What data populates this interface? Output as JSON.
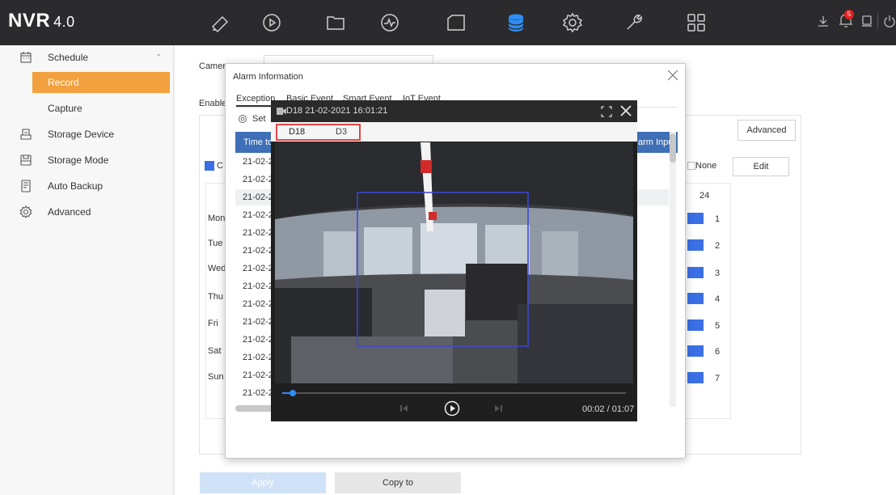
{
  "app": {
    "title": "NVR",
    "version": "4.0"
  },
  "topnav": {
    "icons": [
      "live-view-icon",
      "playback-icon",
      "file-icon",
      "smart-analysis-icon",
      "camera-icon",
      "storage-icon",
      "settings-icon",
      "maintenance-icon",
      "apps-icon"
    ],
    "active": "storage-icon",
    "right_icons": [
      "download-icon",
      "alarm-icon",
      "user-icon",
      "power-icon"
    ],
    "alarm_count": "5"
  },
  "sidebar": {
    "items": [
      {
        "label": "Schedule",
        "icon": "calendar-icon",
        "expanded": true
      },
      {
        "label": "Record",
        "active": true
      },
      {
        "label": "Capture"
      },
      {
        "label": "Storage Device",
        "icon": "storage-device-icon"
      },
      {
        "label": "Storage Mode",
        "icon": "storage-mode-icon"
      },
      {
        "label": "Auto Backup",
        "icon": "backup-icon"
      },
      {
        "label": "Advanced",
        "icon": "gear-icon"
      }
    ]
  },
  "main": {
    "camera_label": "Camer",
    "enable_label": "Enable",
    "advanced_button": "Advanced",
    "legend_partial": "C",
    "none_label": "None",
    "edit_button": "Edit",
    "hour_24": "24",
    "days": [
      "Mon",
      "Tue",
      "Wed",
      "Thu",
      "Fri",
      "Sat",
      "Sun"
    ],
    "day_numbers": [
      "1",
      "2",
      "3",
      "4",
      "5",
      "6",
      "7"
    ],
    "apply_button": "Apply",
    "copy_to_button": "Copy to"
  },
  "alarm_dialog": {
    "title": "Alarm Information",
    "tabs": [
      "Exception",
      "Basic Event",
      "Smart Event",
      "IoT Event"
    ],
    "set_label": "Set",
    "col_time": "Time to",
    "col_alarm_input": "arm Inpu",
    "rows": [
      "21-02-2",
      "21-02-2",
      "21-02-2",
      "21-02-2",
      "21-02-2",
      "21-02-2",
      "21-02-2",
      "21-02-2",
      "21-02-2",
      "21-02-2",
      "21-02-2",
      "21-02-2",
      "21-02-2",
      "21-02-2"
    ]
  },
  "video_popup": {
    "title": "D18 21-02-2021 16:01:21",
    "channels": [
      "D18",
      "D3"
    ],
    "time_display": "00:02 / 01:07",
    "progress": 0.03
  }
}
